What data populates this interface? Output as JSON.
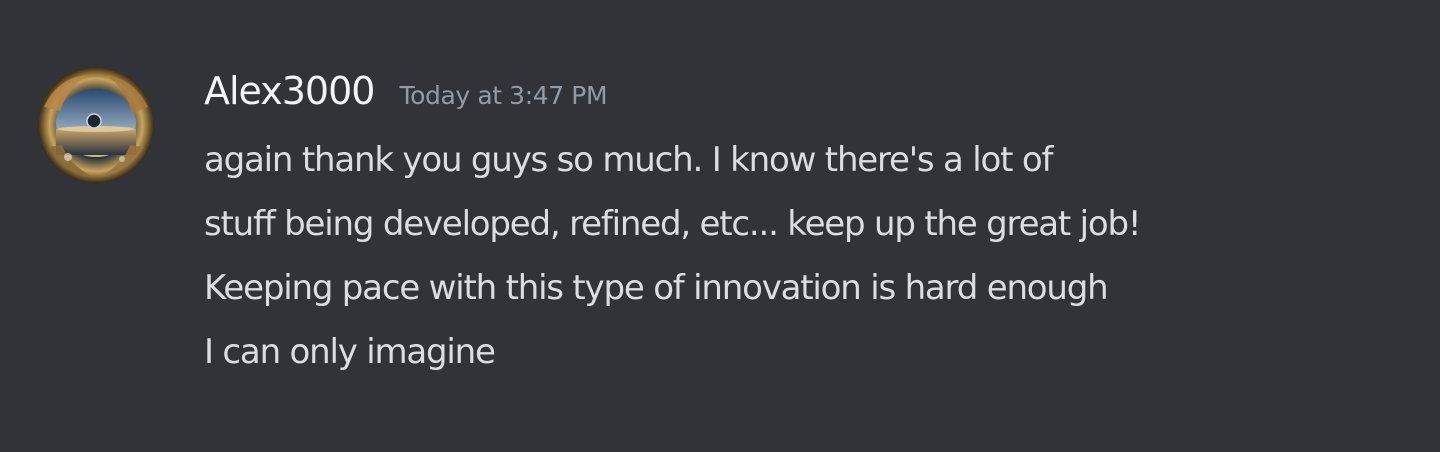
{
  "message": {
    "author": "Alex3000",
    "timestamp": "Today at 3:47 PM",
    "lines": [
      "again thank you guys so much. I know there's a lot of",
      "stuff being developed, refined, etc... keep up the great job!",
      "Keeping pace with this type of innovation is hard enough",
      "I can only imagine"
    ]
  },
  "colors": {
    "background": "#313338",
    "username": "#f2f3f5",
    "timestamp": "#949ba4",
    "text": "#dbdee1"
  }
}
